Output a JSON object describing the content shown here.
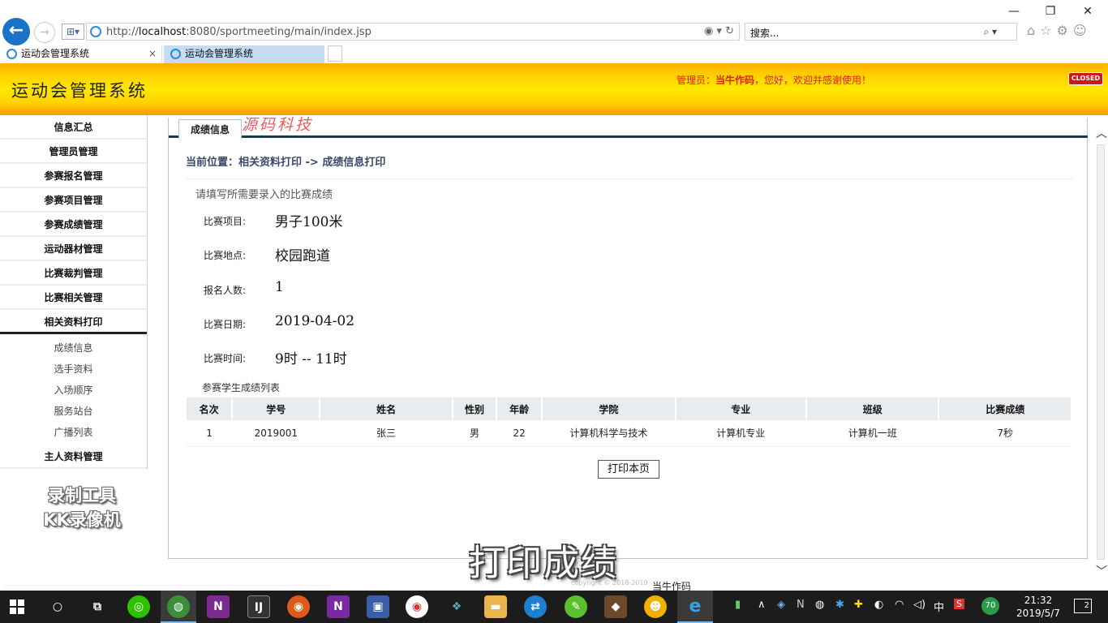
{
  "browser": {
    "url_prefix": "http://",
    "url_host": "localhost",
    "url_rest": ":8080/sportmeeting/main/index.jsp",
    "search_placeholder": "搜索...",
    "tabs": [
      {
        "label": "运动会管理系统"
      },
      {
        "label": "运动会管理系统"
      }
    ],
    "window_buttons": {
      "minimize": "—",
      "restore": "❐",
      "close": "✕"
    }
  },
  "header": {
    "title": "运动会管理系统",
    "welcome_prefix": "管理员：",
    "welcome_user": "当牛作码",
    "welcome_suffix": "，您好，欢迎并感谢使用！",
    "closed_label": "CLOSED"
  },
  "sidebar": {
    "items": [
      {
        "label": "信息汇总"
      },
      {
        "label": "管理员管理"
      },
      {
        "label": "参赛报名管理"
      },
      {
        "label": "参赛项目管理"
      },
      {
        "label": "参赛成绩管理"
      },
      {
        "label": "运动器材管理"
      },
      {
        "label": "比赛裁判管理"
      },
      {
        "label": "比赛相关管理"
      },
      {
        "label": "相关资料打印"
      }
    ],
    "subitems": [
      {
        "label": "成绩信息"
      },
      {
        "label": "选手资料"
      },
      {
        "label": "入场顺序"
      },
      {
        "label": "服务站台"
      },
      {
        "label": "广播列表"
      }
    ],
    "last_item": "主人资料管理"
  },
  "overlay": {
    "kk_line1": "录制工具",
    "kk_line2": "KK录像机",
    "watermark": "源码科技",
    "caption": "打印成绩"
  },
  "content": {
    "tab_label": "成绩信息",
    "breadcrumb": "当前位置：相关资料打印 -> 成绩信息打印",
    "prompt": "请填写所需要录入的比赛成绩",
    "fields": [
      {
        "label": "比赛项目:",
        "value": "男子100米"
      },
      {
        "label": "比赛地点:",
        "value": "校园跑道"
      },
      {
        "label": "报名人数:",
        "value": "1"
      },
      {
        "label": "比赛日期:",
        "value": "2019-04-02"
      },
      {
        "label": "比赛时间:",
        "value": "9时 -- 11时"
      }
    ],
    "list_title": "参赛学生成绩列表",
    "table": {
      "headers": [
        "名次",
        "学号",
        "姓名",
        "性别",
        "年龄",
        "学院",
        "专业",
        "班级",
        "比赛成绩"
      ],
      "rows": [
        [
          "1",
          "2019001",
          "张三",
          "男",
          "22",
          "计算机科学与技术",
          "计算机专业",
          "计算机一班",
          "7秒"
        ]
      ]
    },
    "print_button": "打印本页"
  },
  "footer": {
    "copyright": "copyright © 2018-2019",
    "author": "当牛作码"
  },
  "taskbar": {
    "time": "21:32",
    "date": "2019/5/7",
    "ime": "中",
    "badge": "70",
    "notifications": "2"
  }
}
